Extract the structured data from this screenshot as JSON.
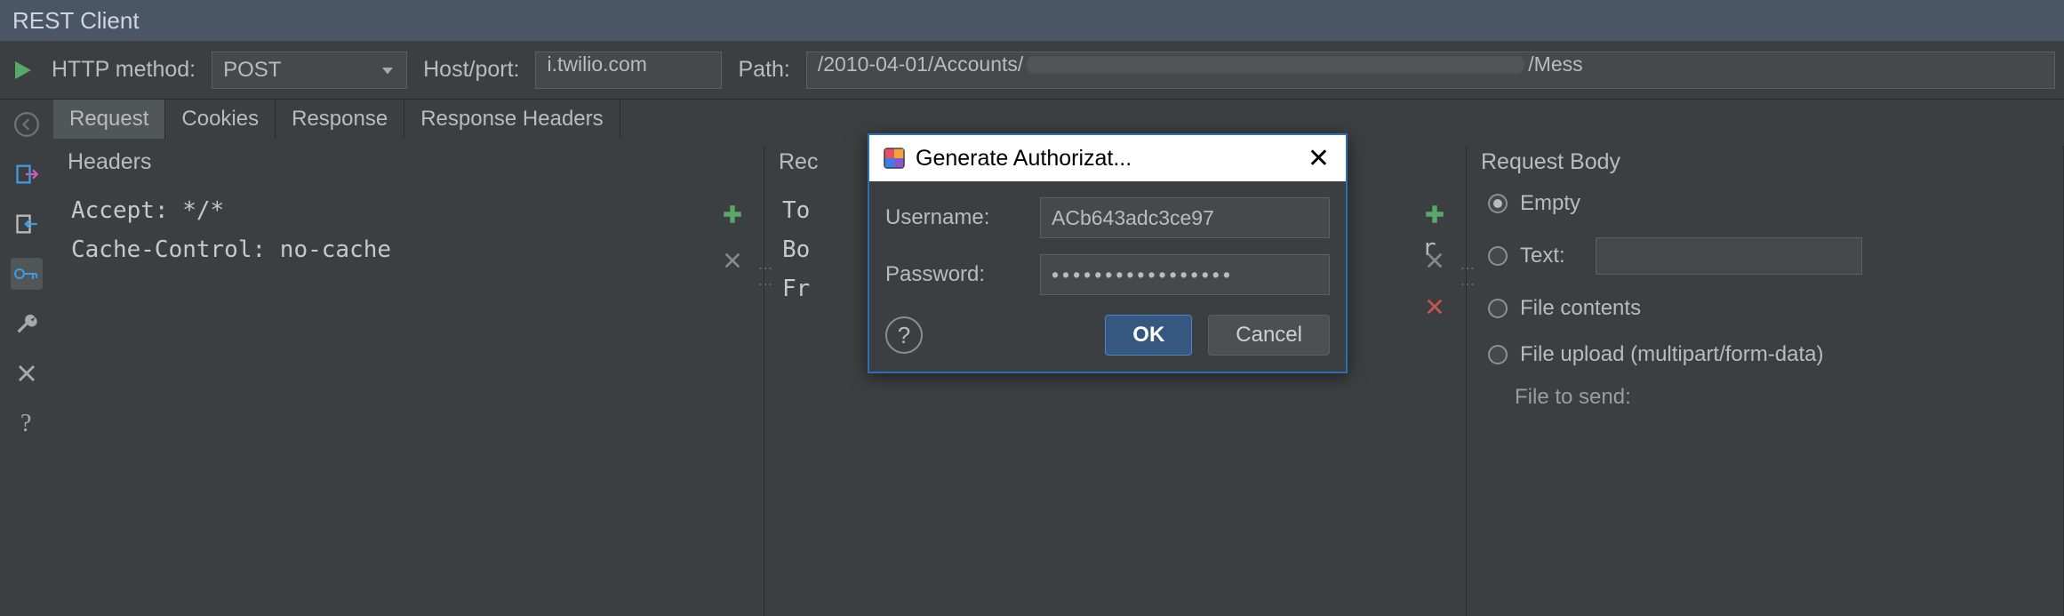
{
  "window": {
    "title": "REST Client"
  },
  "config": {
    "method_label": "HTTP method:",
    "method_value": "POST",
    "host_label": "Host/port:",
    "host_value": "i.twilio.com",
    "path_label": "Path:",
    "path_prefix": "/2010-04-01/Accounts/",
    "path_suffix": "/Mess"
  },
  "tabs": [
    "Request",
    "Cookies",
    "Response",
    "Response Headers"
  ],
  "headers_panel": {
    "title": "Headers",
    "lines": "Accept: */*\nCache-Control: no-cache"
  },
  "params_panel": {
    "title": "Rec",
    "lines": "To\nBo\nFr"
  },
  "body_panel": {
    "title": "Request Body",
    "options": {
      "empty": "Empty",
      "text": "Text:",
      "file": "File contents",
      "upload": "File upload (multipart/form-data)"
    },
    "file_to_send": "File to send:"
  },
  "dialog": {
    "title": "Generate Authorizat...",
    "username_label": "Username:",
    "username_value": "ACb643adc3ce97",
    "password_label": "Password:",
    "password_value": "•••••••••••••••••",
    "ok": "OK",
    "cancel": "Cancel"
  },
  "icons": {
    "params_extra": "r"
  }
}
